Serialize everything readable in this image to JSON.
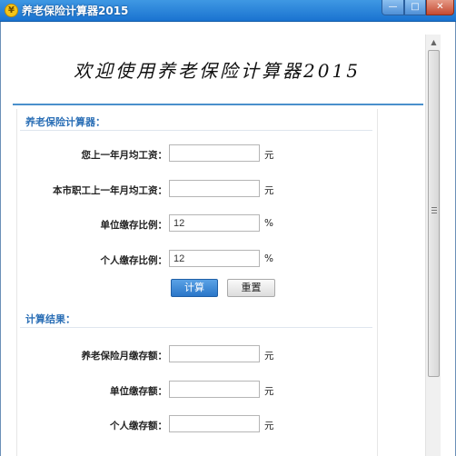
{
  "window": {
    "title": "养老保险计算器2015",
    "icon": "¥",
    "min_glyph": "—",
    "max_glyph": "□",
    "close_glyph": "✕"
  },
  "banner": "欢迎使用养老保险计算器2015",
  "calculator": {
    "section_title": "养老保险计算器：",
    "rows": [
      {
        "label": "您上一年月均工资：",
        "value": "",
        "unit": "元"
      },
      {
        "label": "本市职工上一年月均工资：",
        "value": "",
        "unit": "元"
      },
      {
        "label": "单位缴存比例：",
        "value": "12",
        "unit": "%"
      },
      {
        "label": "个人缴存比例：",
        "value": "12",
        "unit": "%"
      }
    ],
    "calc_button": "计算",
    "reset_button": "重置"
  },
  "results": {
    "section_title": "计算结果：",
    "rows": [
      {
        "label": "养老保险月缴存额：",
        "value": "",
        "unit": "元"
      },
      {
        "label": "单位缴存额：",
        "value": "",
        "unit": "元"
      },
      {
        "label": "个人缴存额：",
        "value": "",
        "unit": "元"
      }
    ]
  },
  "colors": {
    "title_bar": "#1a73d0",
    "section_title": "#2b6fb6",
    "primary_button": "#2a76c8"
  }
}
